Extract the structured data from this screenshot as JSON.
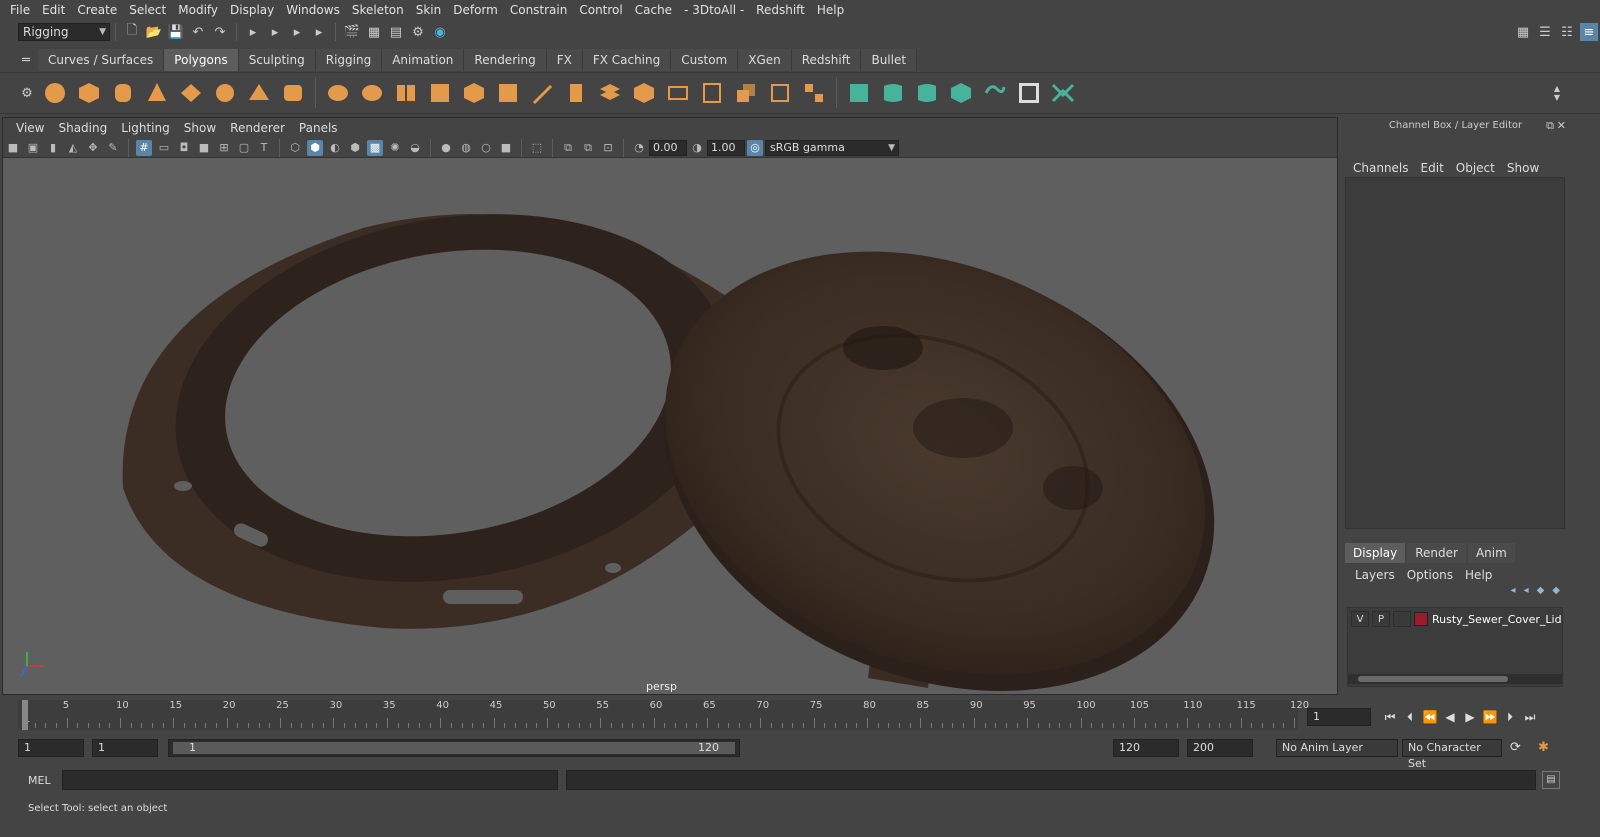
{
  "menubar": [
    "File",
    "Edit",
    "Create",
    "Select",
    "Modify",
    "Display",
    "Windows",
    "Skeleton",
    "Skin",
    "Deform",
    "Constrain",
    "Control",
    "Cache",
    "- 3DtoAll -",
    "Redshift",
    "Help"
  ],
  "status": {
    "mode": "Rigging"
  },
  "shelf": {
    "tabs": [
      "Curves / Surfaces",
      "Polygons",
      "Sculpting",
      "Rigging",
      "Animation",
      "Rendering",
      "FX",
      "FX Caching",
      "Custom",
      "XGen",
      "Redshift",
      "Bullet"
    ],
    "active_tab": "Polygons"
  },
  "viewport": {
    "menu": [
      "View",
      "Shading",
      "Lighting",
      "Show",
      "Renderer",
      "Panels"
    ],
    "exposure": "0.00",
    "gamma": "1.00",
    "color_space": "sRGB gamma",
    "camera": "persp"
  },
  "channel_box": {
    "title": "Channel Box / Layer Editor",
    "menu": [
      "Channels",
      "Edit",
      "Object",
      "Show"
    ]
  },
  "layer_editor": {
    "tabs": [
      "Display",
      "Render",
      "Anim"
    ],
    "active_tab": "Display",
    "menu": [
      "Layers",
      "Options",
      "Help"
    ],
    "layer": {
      "v": "V",
      "p": "P",
      "name": "Rusty_Sewer_Cover_Lid",
      "color": "#9b1b2d"
    }
  },
  "timeline": {
    "start_label": "1",
    "labels": [
      "5",
      "10",
      "15",
      "20",
      "25",
      "30",
      "35",
      "40",
      "45",
      "50",
      "55",
      "60",
      "65",
      "70",
      "75",
      "80",
      "85",
      "90",
      "95",
      "100",
      "105",
      "110",
      "115",
      "120"
    ],
    "current_frame": "1"
  },
  "range": {
    "start": "1",
    "playback_start": "1",
    "slider_start": "1",
    "slider_end": "120",
    "playback_end": "120",
    "end": "200",
    "anim_layer": "No Anim Layer",
    "character_set": "No Character Set"
  },
  "command": {
    "label": "MEL"
  },
  "help_line": "Select Tool: select an object"
}
